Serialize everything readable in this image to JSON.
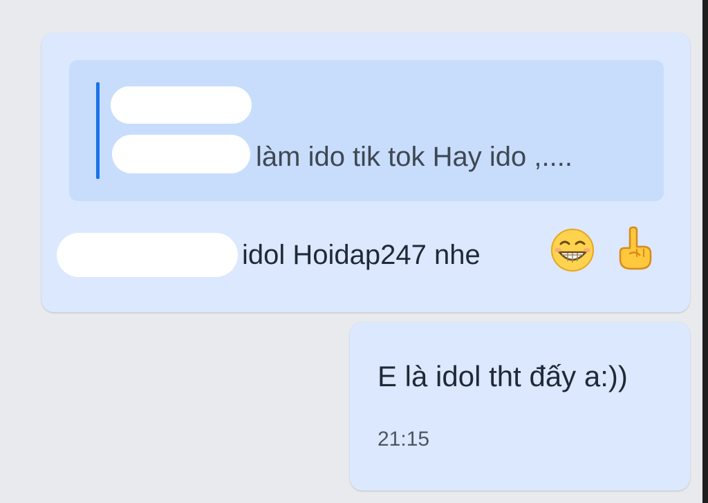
{
  "quoted_message": {
    "text": "làm ido tik tok Hay ido ,....",
    "sender_redacted": true
  },
  "message": {
    "text": "idol Hoidap247 nhe",
    "emojis": [
      "grinning-face-emoji",
      "pointing-up-hand-emoji"
    ]
  },
  "reply": {
    "text": "E là idol tht đấy a:))",
    "time": "21:15"
  },
  "colors": {
    "background": "#e8eaee",
    "bubble": "#dbe8fd",
    "quote_background": "#c7ddfb",
    "quote_bar": "#1a73e8"
  }
}
